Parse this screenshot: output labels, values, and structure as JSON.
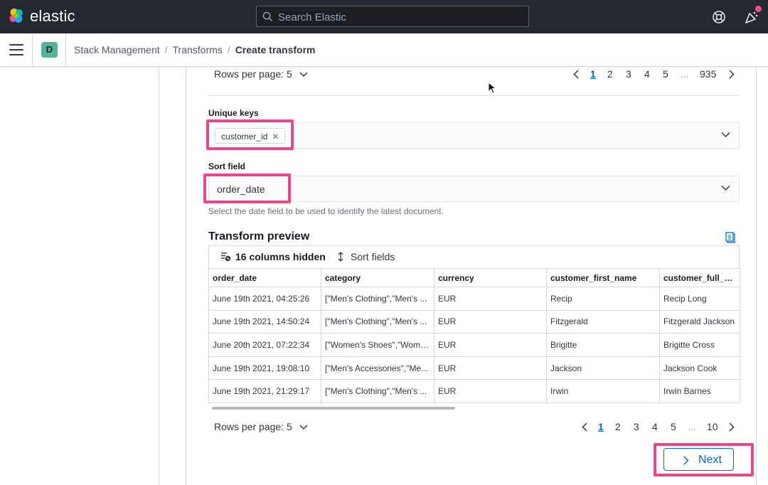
{
  "header": {
    "brand": "elastic",
    "search_placeholder": "Search Elastic"
  },
  "breadcrumbs": {
    "space_initial": "D",
    "items": [
      "Stack Management",
      "Transforms",
      "Create transform"
    ]
  },
  "top_pagination": {
    "rows_per_page": "Rows per page: 5",
    "pages": [
      "1",
      "2",
      "3",
      "4",
      "5",
      "...",
      "935"
    ],
    "active_page": "1"
  },
  "unique_keys": {
    "label": "Unique keys",
    "values": [
      "customer_id"
    ]
  },
  "sort_field": {
    "label": "Sort field",
    "value": "order_date",
    "help": "Select the date field to be used to identify the latest document."
  },
  "preview": {
    "title": "Transform preview",
    "toolbar": {
      "hidden_columns": "16 columns hidden",
      "sort_fields": "Sort fields"
    },
    "columns": [
      "order_date",
      "category",
      "currency",
      "customer_first_name",
      "customer_full_name"
    ],
    "rows": [
      [
        "June 19th 2021, 04:25:26",
        "[\"Men's Clothing\",\"Men's ...",
        "EUR",
        "Recip",
        "Recip Long"
      ],
      [
        "June 19th 2021, 14:50:24",
        "[\"Men's Clothing\",\"Men's ...",
        "EUR",
        "Fitzgerald",
        "Fitzgerald Jackson"
      ],
      [
        "June 20th 2021, 07:22:34",
        "[\"Women's Shoes\",\"Wome...",
        "EUR",
        "Brigitte",
        "Brigitte Cross"
      ],
      [
        "June 19th 2021, 19:08:10",
        "[\"Men's Accessories\",\"Me...",
        "EUR",
        "Jackson",
        "Jackson Cook"
      ],
      [
        "June 19th 2021, 21:29:17",
        "[\"Men's Clothing\",\"Men's ...",
        "EUR",
        "Irwin",
        "Irwin Barnes"
      ]
    ]
  },
  "bottom_pagination": {
    "rows_per_page": "Rows per page: 5",
    "pages": [
      "1",
      "2",
      "3",
      "4",
      "5",
      "...",
      "10"
    ],
    "active_page": "1"
  },
  "actions": {
    "next_label": "Next"
  },
  "colors": {
    "header_bg": "#25282f",
    "accent": "#006bb8",
    "highlight": "#e8478b",
    "space_avatar": "#54b399"
  }
}
